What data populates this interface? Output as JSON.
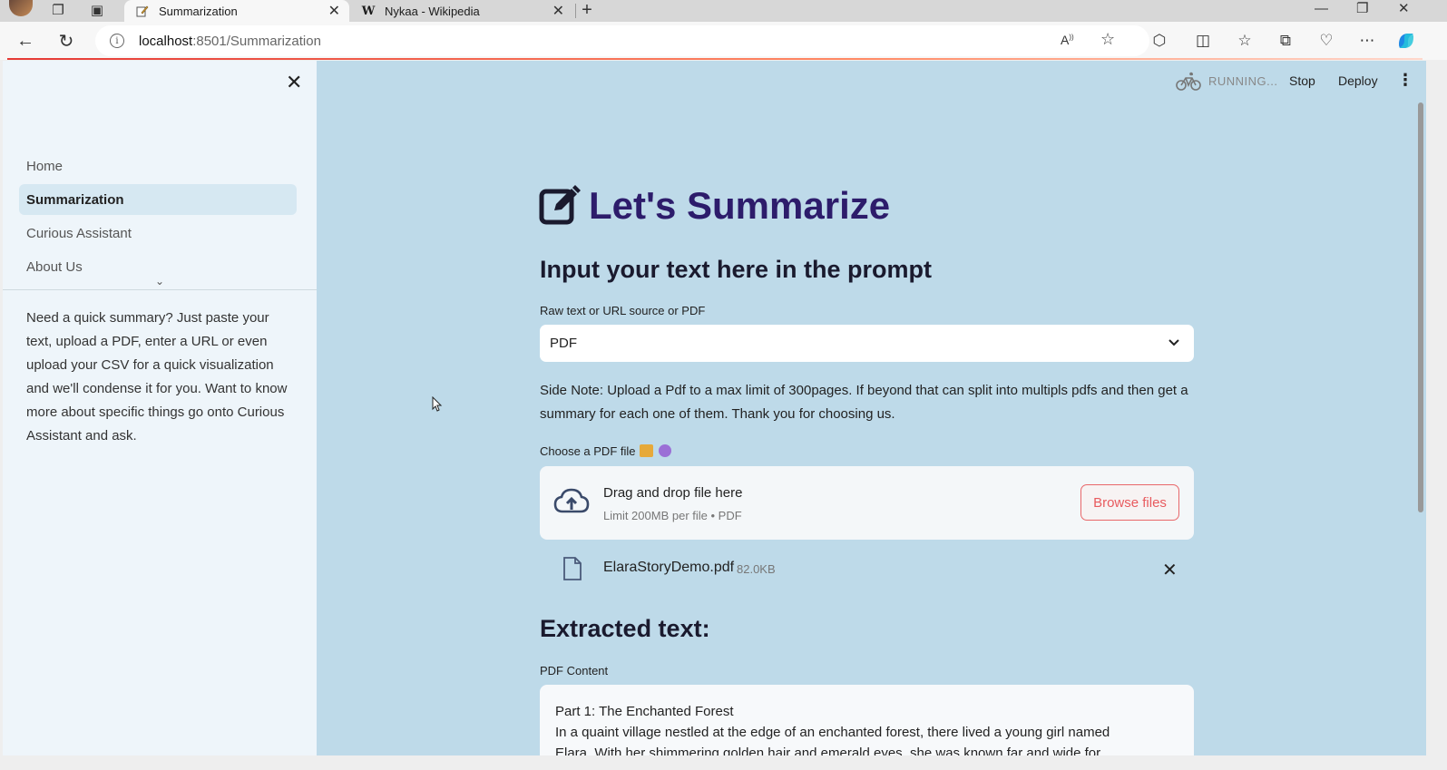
{
  "browser": {
    "tabs": [
      {
        "title": "Summarization",
        "active": true,
        "favicon": "pencil-icon"
      },
      {
        "title": "Nykaa - Wikipedia",
        "active": false,
        "favicon": "W"
      }
    ],
    "url_host": "localhost",
    "url_path": ":8501/Summarization",
    "read_aloud_label": "A"
  },
  "sidebar": {
    "nav": [
      {
        "label": "Home",
        "active": false
      },
      {
        "label": "Summarization",
        "active": true
      },
      {
        "label": "Curious Assistant",
        "active": false
      },
      {
        "label": "About Us",
        "active": false
      }
    ],
    "description": "Need a quick summary? Just paste your text, upload a PDF, enter a URL or even upload your CSV for a quick visualization and we'll condense it for you. Want to know more about specific things go onto Curious Assistant and ask."
  },
  "header": {
    "status": "RUNNING...",
    "stop_label": "Stop",
    "deploy_label": "Deploy"
  },
  "main": {
    "title": "Let's Summarize",
    "subtitle": "Input your text here in the prompt",
    "source_label": "Raw text or URL source or PDF",
    "source_value": "PDF",
    "side_note": "Side Note: Upload a Pdf to a max limit of 300pages. If beyond that can split into multipls pdfs and then get a summary for each one of them. Thank you for choosing us.",
    "choose_label": "Choose a PDF file",
    "uploader": {
      "main_text": "Drag and drop file here",
      "sub_text": "Limit 200MB per file • PDF",
      "browse_label": "Browse files"
    },
    "file": {
      "name": "ElaraStoryDemo.pdf",
      "size": "82.0KB"
    },
    "extracted_heading": "Extracted text:",
    "content_label": "PDF Content",
    "content_lines": [
      "Part 1: The Enchanted Forest",
      "In a quaint village nestled at the edge of an enchanted forest, there lived a young girl named",
      "Elara. With her shimmering golden hair and emerald eyes, she was known far and wide for"
    ]
  },
  "colors": {
    "main_bg": "#bedae9",
    "sidebar_bg": "#eef5fa",
    "title_color": "#2d1c6b",
    "accent_red": "#e85a5e"
  }
}
